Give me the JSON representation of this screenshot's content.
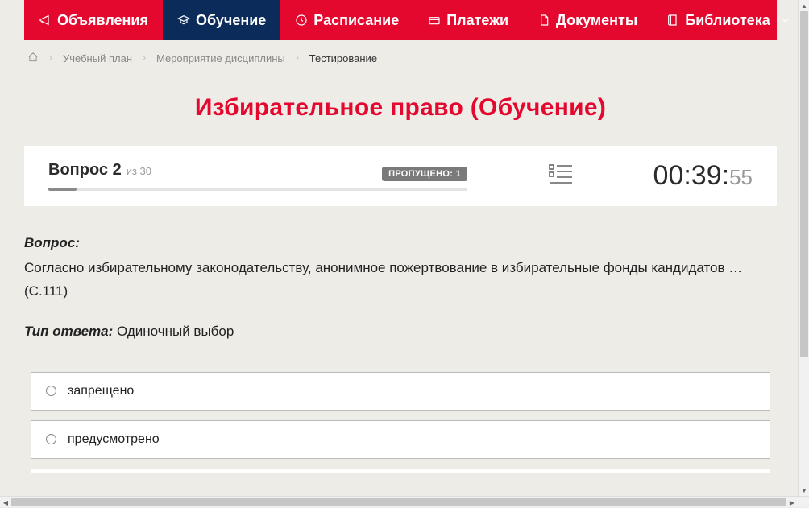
{
  "nav": {
    "items": [
      {
        "label": "Объявления",
        "icon": "megaphone"
      },
      {
        "label": "Обучение",
        "icon": "graduation",
        "active": true
      },
      {
        "label": "Расписание",
        "icon": "clock"
      },
      {
        "label": "Платежи",
        "icon": "payment"
      },
      {
        "label": "Документы",
        "icon": "document"
      },
      {
        "label": "Библиотека",
        "icon": "book",
        "dropdown": true
      }
    ]
  },
  "breadcrumb": {
    "items": [
      {
        "label": "Учебный план"
      },
      {
        "label": "Мероприятие дисциплины"
      }
    ],
    "current": "Тестирование"
  },
  "page_title": "Избирательное право (Обучение)",
  "status": {
    "question_label": "Вопрос 2",
    "total_label": "из 30",
    "skipped_label": "ПРОПУЩЕНО: 1",
    "progress_percent": 6.7,
    "timer_main": "00:39:",
    "timer_seconds": "55"
  },
  "question": {
    "label": "Вопрос:",
    "text": "Согласно избирательному законодательству, анонимное пожертвование в избирательные фонды кандидатов …",
    "reference": "(С.111)"
  },
  "answer_type": {
    "label": "Тип ответа:",
    "value": "Одиночный выбор"
  },
  "options": [
    {
      "text": "запрещено"
    },
    {
      "text": "предусмотрено"
    }
  ]
}
